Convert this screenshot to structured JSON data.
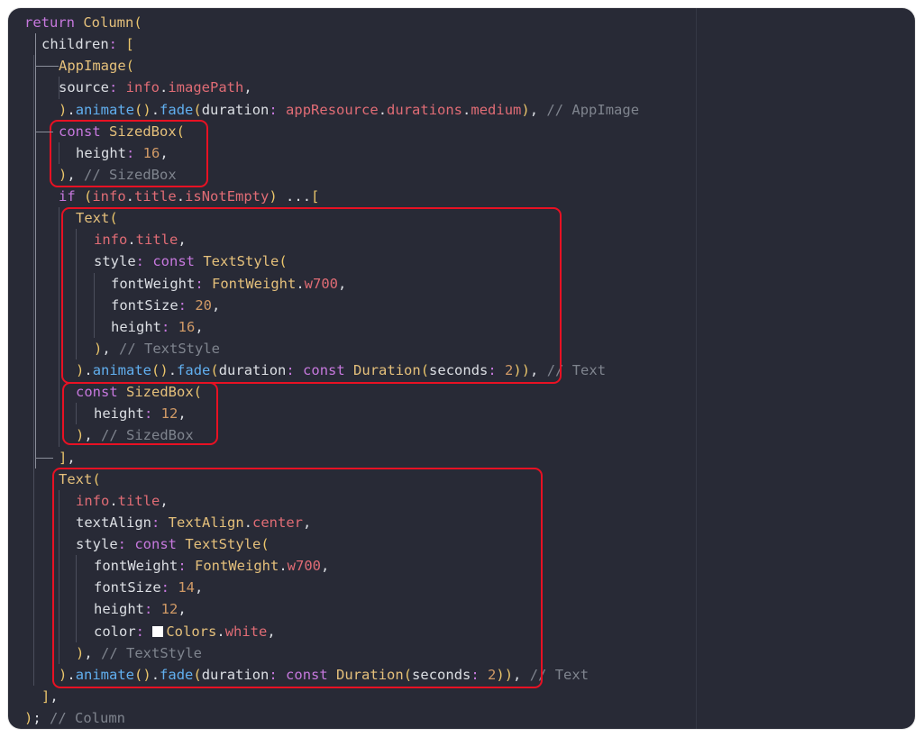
{
  "editor": {
    "lines": [
      {
        "segs": [
          [
            "k",
            "return "
          ],
          [
            "c",
            "Column"
          ],
          [
            "p",
            "("
          ]
        ]
      },
      {
        "segs": [
          [
            "t",
            "children"
          ],
          [
            "k",
            ": "
          ],
          [
            "p",
            "["
          ]
        ]
      },
      {
        "segs": [
          [
            "c",
            "AppImage"
          ],
          [
            "p",
            "("
          ]
        ]
      },
      {
        "segs": [
          [
            "t",
            "source"
          ],
          [
            "k",
            ": "
          ],
          [
            "pr",
            "info"
          ],
          [
            "t",
            "."
          ],
          [
            "pr",
            "imagePath"
          ],
          [
            "t",
            ","
          ]
        ]
      },
      {
        "segs": [
          [
            "p",
            ")"
          ],
          [
            "t",
            "."
          ],
          [
            "fn",
            "animate"
          ],
          [
            "p",
            "()"
          ],
          [
            "t",
            "."
          ],
          [
            "fn",
            "fade"
          ],
          [
            "p",
            "("
          ],
          [
            "t",
            "duration"
          ],
          [
            "k",
            ": "
          ],
          [
            "pr",
            "appResource"
          ],
          [
            "t",
            "."
          ],
          [
            "pr",
            "durations"
          ],
          [
            "t",
            "."
          ],
          [
            "pr",
            "medium"
          ],
          [
            "p",
            ")"
          ],
          [
            "t",
            ", "
          ],
          [
            "cm",
            "// AppImage"
          ]
        ]
      },
      {
        "segs": [
          [
            "k",
            "const "
          ],
          [
            "c",
            "SizedBox"
          ],
          [
            "p",
            "("
          ]
        ]
      },
      {
        "segs": [
          [
            "t",
            "height"
          ],
          [
            "k",
            ": "
          ],
          [
            "n",
            "16"
          ],
          [
            "t",
            ","
          ]
        ]
      },
      {
        "segs": [
          [
            "p",
            ")"
          ],
          [
            "t",
            ", "
          ],
          [
            "cm",
            "// SizedBox"
          ]
        ]
      },
      {
        "segs": [
          [
            "k",
            "if "
          ],
          [
            "p",
            "("
          ],
          [
            "pr",
            "info"
          ],
          [
            "t",
            "."
          ],
          [
            "pr",
            "title"
          ],
          [
            "t",
            "."
          ],
          [
            "pr",
            "isNotEmpty"
          ],
          [
            "p",
            ")"
          ],
          [
            "t",
            " ..."
          ],
          [
            "p",
            "["
          ]
        ]
      },
      {
        "segs": [
          [
            "c",
            "Text"
          ],
          [
            "p",
            "("
          ]
        ]
      },
      {
        "segs": [
          [
            "pr",
            "info"
          ],
          [
            "t",
            "."
          ],
          [
            "pr",
            "title"
          ],
          [
            "t",
            ","
          ]
        ]
      },
      {
        "segs": [
          [
            "t",
            "style"
          ],
          [
            "k",
            ": "
          ],
          [
            "k",
            "const "
          ],
          [
            "c",
            "TextStyle"
          ],
          [
            "p",
            "("
          ]
        ]
      },
      {
        "segs": [
          [
            "t",
            "fontWeight"
          ],
          [
            "k",
            ": "
          ],
          [
            "c",
            "FontWeight"
          ],
          [
            "t",
            "."
          ],
          [
            "pr",
            "w700"
          ],
          [
            "t",
            ","
          ]
        ]
      },
      {
        "segs": [
          [
            "t",
            "fontSize"
          ],
          [
            "k",
            ": "
          ],
          [
            "n",
            "20"
          ],
          [
            "t",
            ","
          ]
        ]
      },
      {
        "segs": [
          [
            "t",
            "height"
          ],
          [
            "k",
            ": "
          ],
          [
            "n",
            "16"
          ],
          [
            "t",
            ","
          ]
        ]
      },
      {
        "segs": [
          [
            "p",
            ")"
          ],
          [
            "t",
            ", "
          ],
          [
            "cm",
            "// TextStyle"
          ]
        ]
      },
      {
        "segs": [
          [
            "p",
            ")"
          ],
          [
            "t",
            "."
          ],
          [
            "fn",
            "animate"
          ],
          [
            "p",
            "()"
          ],
          [
            "t",
            "."
          ],
          [
            "fn",
            "fade"
          ],
          [
            "p",
            "("
          ],
          [
            "t",
            "duration"
          ],
          [
            "k",
            ": "
          ],
          [
            "k",
            "const "
          ],
          [
            "c",
            "Duration"
          ],
          [
            "p",
            "("
          ],
          [
            "t",
            "seconds"
          ],
          [
            "k",
            ": "
          ],
          [
            "n",
            "2"
          ],
          [
            "p",
            "))"
          ],
          [
            "t",
            ", "
          ],
          [
            "cm",
            "// Text"
          ]
        ]
      },
      {
        "segs": [
          [
            "k",
            "const "
          ],
          [
            "c",
            "SizedBox"
          ],
          [
            "p",
            "("
          ]
        ]
      },
      {
        "segs": [
          [
            "t",
            "height"
          ],
          [
            "k",
            ": "
          ],
          [
            "n",
            "12"
          ],
          [
            "t",
            ","
          ]
        ]
      },
      {
        "segs": [
          [
            "p",
            ")"
          ],
          [
            "t",
            ", "
          ],
          [
            "cm",
            "// SizedBox"
          ]
        ]
      },
      {
        "segs": [
          [
            "p",
            "]"
          ],
          [
            "t",
            ","
          ]
        ]
      },
      {
        "segs": [
          [
            "c",
            "Text"
          ],
          [
            "p",
            "("
          ]
        ]
      },
      {
        "segs": [
          [
            "pr",
            "info"
          ],
          [
            "t",
            "."
          ],
          [
            "pr",
            "title"
          ],
          [
            "t",
            ","
          ]
        ]
      },
      {
        "segs": [
          [
            "t",
            "textAlign"
          ],
          [
            "k",
            ": "
          ],
          [
            "c",
            "TextAlign"
          ],
          [
            "t",
            "."
          ],
          [
            "pr",
            "center"
          ],
          [
            "t",
            ","
          ]
        ]
      },
      {
        "segs": [
          [
            "t",
            "style"
          ],
          [
            "k",
            ": "
          ],
          [
            "k",
            "const "
          ],
          [
            "c",
            "TextStyle"
          ],
          [
            "p",
            "("
          ]
        ]
      },
      {
        "segs": [
          [
            "t",
            "fontWeight"
          ],
          [
            "k",
            ": "
          ],
          [
            "c",
            "FontWeight"
          ],
          [
            "t",
            "."
          ],
          [
            "pr",
            "w700"
          ],
          [
            "t",
            ","
          ]
        ]
      },
      {
        "segs": [
          [
            "t",
            "fontSize"
          ],
          [
            "k",
            ": "
          ],
          [
            "n",
            "14"
          ],
          [
            "t",
            ","
          ]
        ]
      },
      {
        "segs": [
          [
            "t",
            "height"
          ],
          [
            "k",
            ": "
          ],
          [
            "n",
            "12"
          ],
          [
            "t",
            ","
          ]
        ]
      },
      {
        "segs": [
          [
            "t",
            "color"
          ],
          [
            "k",
            ": "
          ],
          [
            "sw",
            ""
          ],
          [
            "c",
            "Colors"
          ],
          [
            "t",
            "."
          ],
          [
            "pr",
            "white"
          ],
          [
            "t",
            ","
          ]
        ]
      },
      {
        "segs": [
          [
            "p",
            ")"
          ],
          [
            "t",
            ", "
          ],
          [
            "cm",
            "// TextStyle"
          ]
        ]
      },
      {
        "segs": [
          [
            "p",
            ")"
          ],
          [
            "t",
            "."
          ],
          [
            "fn",
            "animate"
          ],
          [
            "p",
            "()"
          ],
          [
            "t",
            "."
          ],
          [
            "fn",
            "fade"
          ],
          [
            "p",
            "("
          ],
          [
            "t",
            "duration"
          ],
          [
            "k",
            ": "
          ],
          [
            "k",
            "const "
          ],
          [
            "c",
            "Duration"
          ],
          [
            "p",
            "("
          ],
          [
            "t",
            "seconds"
          ],
          [
            "k",
            ": "
          ],
          [
            "n",
            "2"
          ],
          [
            "p",
            "))"
          ],
          [
            "t",
            ", "
          ],
          [
            "cm",
            "// Text"
          ]
        ]
      },
      {
        "segs": [
          [
            "p",
            "]"
          ],
          [
            "t",
            ","
          ]
        ]
      },
      {
        "segs": [
          [
            "p",
            ")"
          ],
          [
            "t",
            "; "
          ],
          [
            "cm",
            "// Column"
          ]
        ]
      }
    ]
  },
  "colors": {
    "background": "#282a36",
    "highlight_box": "#e81123"
  }
}
